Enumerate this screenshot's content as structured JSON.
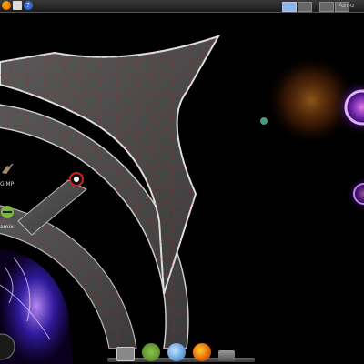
{
  "top_panel": {
    "launchers": [
      {
        "icon": "firefox-icon",
        "color": "#e66000"
      },
      {
        "icon": "mail-icon",
        "color": "#d0d0d0"
      },
      {
        "icon": "help-icon",
        "color": "#3a6ad0"
      }
    ],
    "workspaces": [
      {
        "name": "workspace-1",
        "active": true
      },
      {
        "name": "workspace-2",
        "active": false
      },
      {
        "name": "workspace-3",
        "active": false
      },
      {
        "name": "workspace-4",
        "active": false
      }
    ],
    "user": "Azou"
  },
  "desktop_icons": [
    {
      "label": "GIMP",
      "icon": "gimp-icon"
    },
    {
      "label": "amix",
      "icon": "android-icon"
    }
  ],
  "dock": {
    "items": [
      {
        "icon": "monitor-icon",
        "label": ""
      },
      {
        "icon": "android-icon",
        "label": ""
      },
      {
        "icon": "bird-icon",
        "label": ""
      },
      {
        "icon": "firefox-icon",
        "label": ""
      },
      {
        "icon": "trash-icon",
        "label": ""
      }
    ]
  },
  "colors": {
    "background": "#000000",
    "blade": "#4a4a4a",
    "vein": "#b02020",
    "glow_purple": "#8a2be2",
    "glow_orange": "#ff8c1a"
  }
}
